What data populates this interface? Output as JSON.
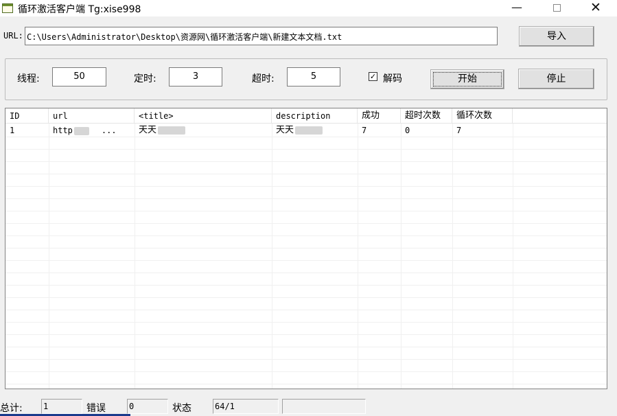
{
  "window": {
    "title": "循环激活客户端 Tg:xise998",
    "minimize_glyph": "—",
    "close_glyph": "✕"
  },
  "url_row": {
    "label": "URL:",
    "value": "C:\\Users\\Administrator\\Desktop\\资源网\\循环激活客户端\\新建文本文档.txt",
    "import_label": "导入"
  },
  "settings": {
    "threads_label": "线程:",
    "threads_value": "50",
    "timer_label": "定时:",
    "timer_value": "3",
    "timeout_label": "超时:",
    "timeout_value": "5",
    "decode_label": "解码",
    "decode_checked_glyph": "✓",
    "start_label": "开始",
    "stop_label": "停止"
  },
  "table": {
    "columns": [
      "ID",
      "url",
      "<title>",
      "description",
      "成功",
      "超时次数",
      "循环次数"
    ],
    "rows": [
      {
        "id": "1",
        "url": "http",
        "url_tail": "...",
        "title": "天天",
        "description": "天天",
        "success": "7",
        "timeouts": "0",
        "loops": "7"
      }
    ]
  },
  "statusbar": {
    "total_label": "总计:",
    "total_value": "1",
    "error_label": "错误",
    "error_value": "0",
    "state_label": "状态",
    "state_value": "64/1"
  },
  "colors": {
    "window_bg": "#f0f0f0",
    "button_bg": "#e1e1e1",
    "taskbar_accent": "#1a3a8c"
  }
}
